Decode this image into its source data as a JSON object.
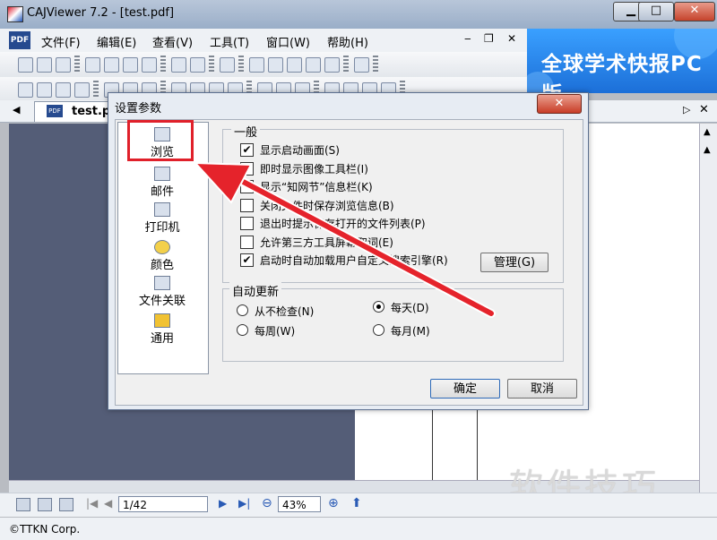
{
  "window": {
    "title": "CAJViewer 7.2 - [test.pdf]",
    "minimize": "▁",
    "maximize": "□",
    "close": "✕"
  },
  "menu": [
    {
      "label": "文件(F)"
    },
    {
      "label": "编辑(E)"
    },
    {
      "label": "查看(V)"
    },
    {
      "label": "工具(T)"
    },
    {
      "label": "窗口(W)"
    },
    {
      "label": "帮助(H)"
    }
  ],
  "mdi": {
    "minimize": "‒",
    "restore": "❐",
    "close": "✕"
  },
  "logo_text": "PDF",
  "banner": {
    "text": "全球学术快报PC版"
  },
  "tab": {
    "label": "test.pdf",
    "icon": "pdf-file-icon"
  },
  "dialog": {
    "title": "设置参数",
    "close": "✕",
    "categories": [
      {
        "label": "浏览",
        "icon": "browse-icon"
      },
      {
        "label": "邮件",
        "icon": "mail-icon"
      },
      {
        "label": "打印机",
        "icon": "printer-icon"
      },
      {
        "label": "颜色",
        "icon": "palette-icon"
      },
      {
        "label": "文件关联",
        "icon": "file-association-icon"
      },
      {
        "label": "通用",
        "icon": "general-icon"
      }
    ],
    "general": {
      "title": "一般",
      "options": [
        {
          "label": "显示启动画面(S)",
          "checked": true
        },
        {
          "label": "即时显示图像工具栏(I)",
          "checked": false
        },
        {
          "label": "显示“知网节”信息栏(K)",
          "checked": false
        },
        {
          "label": "关闭文件时保存浏览信息(B)",
          "checked": false
        },
        {
          "label": "退出时提示保存打开的文件列表(P)",
          "checked": false
        },
        {
          "label": "允许第三方工具屏幕取词(E)",
          "checked": false
        },
        {
          "label": "启动时自动加载用户自定义搜索引擎(R)",
          "checked": true
        }
      ],
      "manage_button": "管理(G)"
    },
    "auto_update": {
      "title": "自动更新",
      "options": [
        {
          "label": "从不检查(N)",
          "selected": false
        },
        {
          "label": "每天(D)",
          "selected": true
        },
        {
          "label": "每周(W)",
          "selected": false
        },
        {
          "label": "每月(M)",
          "selected": false
        }
      ]
    },
    "ok_button": "确定",
    "cancel_button": "取消"
  },
  "navigation": {
    "page": "1/42",
    "zoom": "43%"
  },
  "status": {
    "copyright": "©TTKN Corp."
  },
  "watermark": "软件技巧",
  "colors": {
    "highlight": "#e0202a",
    "arrow": "#e5232b",
    "banner": "#1f78e0",
    "doc_bg": "#545d77"
  }
}
